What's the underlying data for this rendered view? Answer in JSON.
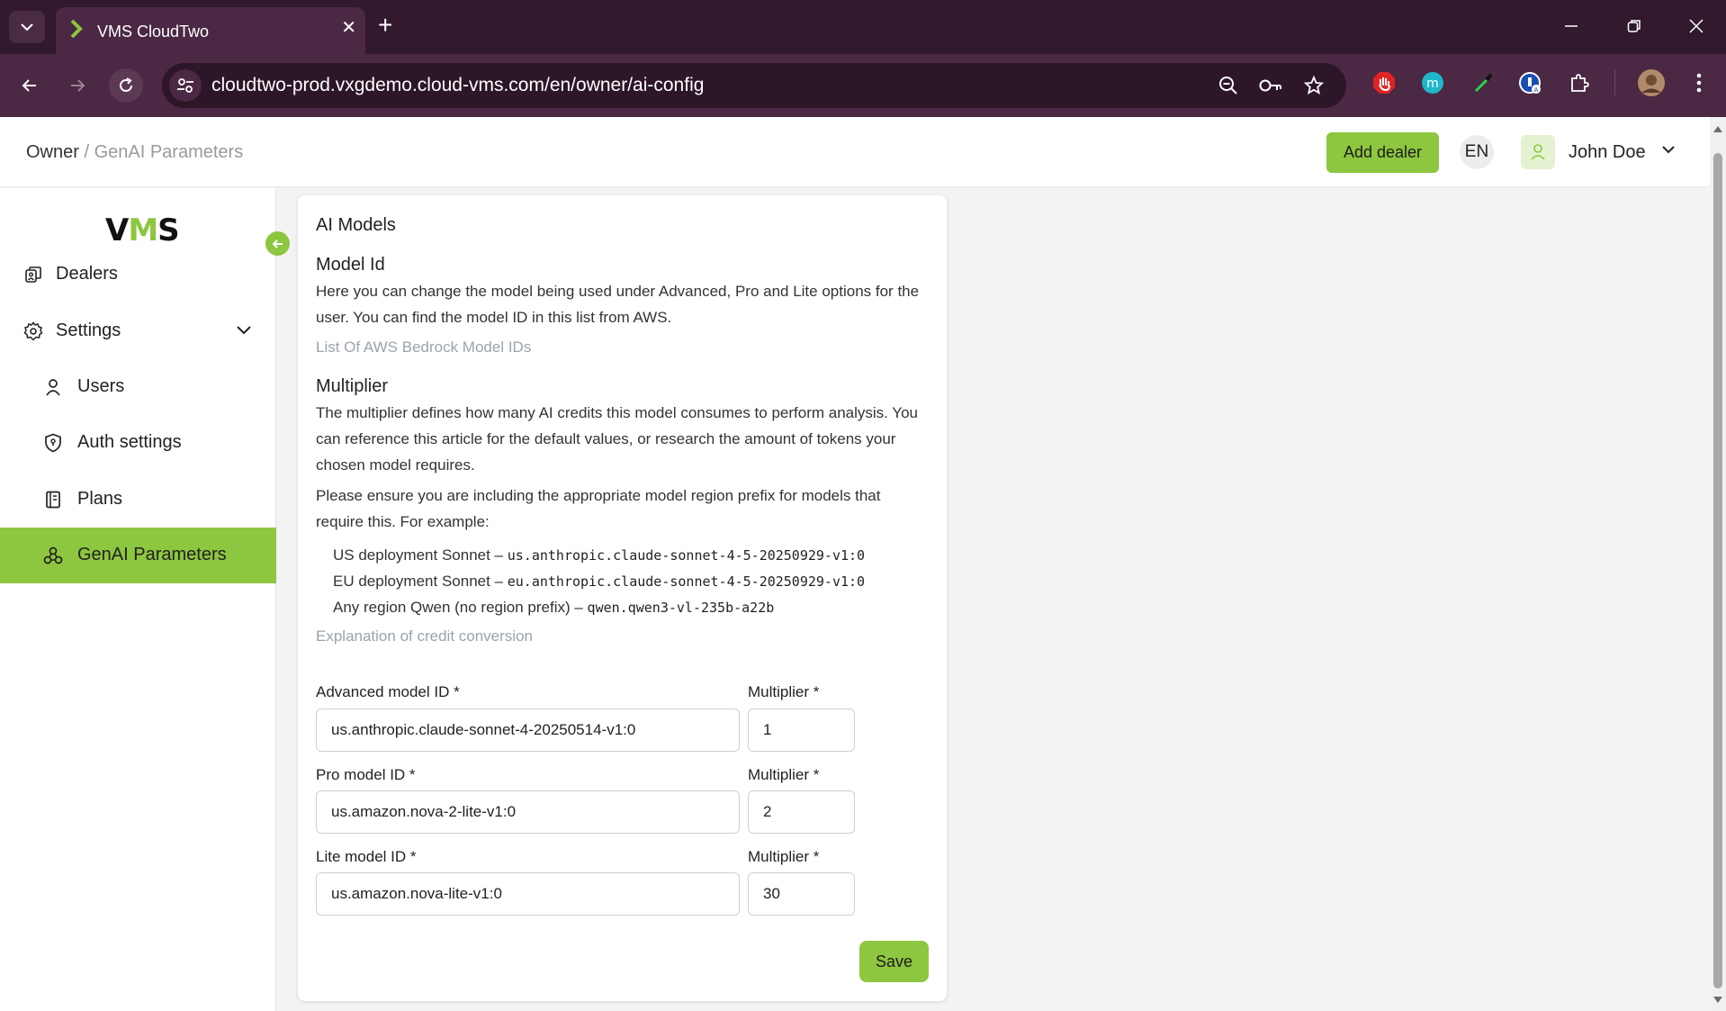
{
  "browser": {
    "tab_title": "VMS CloudTwo",
    "tab_close": "✕",
    "new_tab": "+",
    "url": "cloudtwo-prod.vxgdemo.cloud-vms.com/en/owner/ai-config",
    "extensions": [
      "adblock-icon",
      "m-extension-icon",
      "eyedropper-icon",
      "password-manager-icon",
      "puzzle-icon"
    ]
  },
  "header": {
    "breadcrumb_root": "Owner",
    "breadcrumb_sep": " / ",
    "breadcrumb_current": "GenAI Parameters",
    "add_dealer": "Add dealer",
    "language": "EN",
    "user_name": "John Doe"
  },
  "sidebar": {
    "logo_v": "V",
    "logo_m": "M",
    "logo_s": "S",
    "items": [
      {
        "label": "Dealers"
      },
      {
        "label": "Settings"
      },
      {
        "label": "Users"
      },
      {
        "label": "Auth settings"
      },
      {
        "label": "Plans"
      },
      {
        "label": "GenAI Parameters"
      }
    ]
  },
  "main": {
    "card_title": "AI Models",
    "model_id_title": "Model Id",
    "model_id_text": "Here you can change the model being used under Advanced, Pro and Lite options for the user. You can find the model ID in this list from AWS.",
    "model_id_link": "List Of AWS Bedrock Model IDs",
    "multiplier_title": "Multiplier",
    "multiplier_text": "The multiplier defines how many AI credits this model consumes to perform analysis. You can reference this article for the default values, or research the amount of tokens your chosen model requires.",
    "prefix_text": "Please ensure you are including the appropriate model region prefix for models that require this. For example:",
    "examples": [
      {
        "label": "US deployment Sonnet – ",
        "code": "us.anthropic.claude-sonnet-4-5-20250929-v1:0"
      },
      {
        "label": "EU deployment Sonnet – ",
        "code": "eu.anthropic.claude-sonnet-4-5-20250929-v1:0"
      },
      {
        "label": "Any region Qwen (no region prefix) – ",
        "code": "qwen.qwen3-vl-235b-a22b"
      }
    ],
    "credit_link": "Explanation of credit conversion",
    "fields": [
      {
        "label": "Advanced model ID *",
        "value": "us.anthropic.claude-sonnet-4-20250514-v1:0",
        "mult_label": "Multiplier *",
        "mult_value": "1"
      },
      {
        "label": "Pro model ID *",
        "value": "us.amazon.nova-2-lite-v1:0",
        "mult_label": "Multiplier *",
        "mult_value": "2"
      },
      {
        "label": "Lite model ID *",
        "value": "us.amazon.nova-lite-v1:0",
        "mult_label": "Multiplier *",
        "mult_value": "30"
      }
    ],
    "save": "Save"
  },
  "colors": {
    "accent": "#8dc63f",
    "chrome_dark": "#32192d",
    "chrome_toolbar": "#4b2843"
  }
}
